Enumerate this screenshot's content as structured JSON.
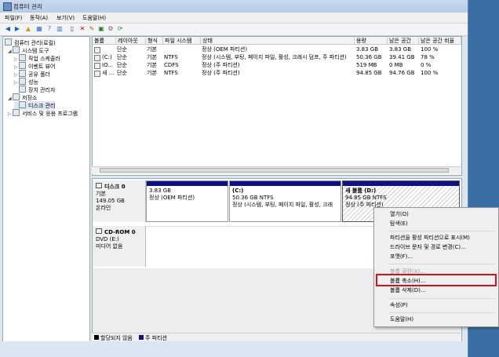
{
  "window": {
    "title": "컴퓨터 관리"
  },
  "menubar": [
    "파일(F)",
    "동작(A)",
    "보기(V)",
    "도움말(H)"
  ],
  "tree": [
    {
      "label": "컴퓨터 관리(로컬)",
      "level": 0,
      "expander": ""
    },
    {
      "label": "시스템 도구",
      "level": 1,
      "expander": "◢"
    },
    {
      "label": "작업 스케줄러",
      "level": 2,
      "expander": "▷"
    },
    {
      "label": "이벤트 뷰어",
      "level": 2,
      "expander": "▷"
    },
    {
      "label": "공유 폴더",
      "level": 2,
      "expander": "▷"
    },
    {
      "label": "성능",
      "level": 2,
      "expander": "▷"
    },
    {
      "label": "장치 관리자",
      "level": 2,
      "expander": ""
    },
    {
      "label": "저장소",
      "level": 1,
      "expander": "◢"
    },
    {
      "label": "디스크 관리",
      "level": 2,
      "expander": ""
    },
    {
      "label": "서비스 및 응용 프로그램",
      "level": 1,
      "expander": "▷"
    }
  ],
  "volume_table": {
    "headers": [
      "볼륨",
      "레이아웃",
      "형식",
      "파일 시스템",
      "상태",
      "용량",
      "남은 공간",
      "남은 공간 비율"
    ],
    "rows": [
      [
        "",
        "단순",
        "기본",
        "",
        "정상 (OEM 파티션)",
        "3.83 GB",
        "3.83 GB",
        "100 %"
      ],
      [
        "(C:)",
        "단순",
        "기본",
        "NTFS",
        "정상 (시스템, 부팅, 페이지 파일, 활성, 크래시 덤프, 주 파티션)",
        "50.36 GB",
        "39.41 GB",
        "78 %"
      ],
      [
        "IO...",
        "단순",
        "기본",
        "CDFS",
        "정상 (주 파티션)",
        "519 MB",
        "0 MB",
        "0 %"
      ],
      [
        "새 ...",
        "단순",
        "기본",
        "NTFS",
        "정상 (주 파티션)",
        "94.85 GB",
        "94.76 GB",
        "100 %"
      ]
    ]
  },
  "disks": [
    {
      "name": "디스크 0",
      "type": "기본",
      "size": "149.05 GB",
      "status": "온라인",
      "partitions": [
        {
          "title": "",
          "size": "3.83 GB",
          "status": "정상 (OEM 파티션)"
        },
        {
          "title": "(C:)",
          "size": "50.36 GB NTFS",
          "status": "정상 (시스템, 부팅, 페이지 파일, 활성, 크래"
        },
        {
          "title": "새 볼륨 (D:)",
          "size": "94.85 GB NTFS",
          "status": "정상 (주 파티션)"
        }
      ]
    },
    {
      "name": "CD-ROM 0",
      "type": "DVD (E:)",
      "size": "",
      "status": "미디어 없음",
      "partitions": []
    }
  ],
  "legend": [
    {
      "label": "할당되지 않음",
      "color": "#000000"
    },
    {
      "label": "주 파티션",
      "color": "#10108a"
    }
  ],
  "context_menu": [
    {
      "label": "열기(O)",
      "disabled": false
    },
    {
      "label": "탐색(E)",
      "disabled": false
    },
    {
      "label": "파티션을 활성 파티션으로 표시(M)",
      "disabled": false
    },
    {
      "label": "드라이브 문자 및 경로 변경(C)...",
      "disabled": false
    },
    {
      "label": "포맷(F)...",
      "disabled": false
    },
    {
      "label": "볼륨 확장(X)...",
      "disabled": true
    },
    {
      "label": "볼륨 축소(H)...",
      "disabled": false
    },
    {
      "label": "볼륨 삭제(D)...",
      "disabled": false
    },
    {
      "label": "속성(P)",
      "disabled": false
    },
    {
      "label": "도움말(H)",
      "disabled": false
    }
  ],
  "colors": {
    "primary_partition": "#10108a",
    "highlight_box": "#d4121d"
  }
}
